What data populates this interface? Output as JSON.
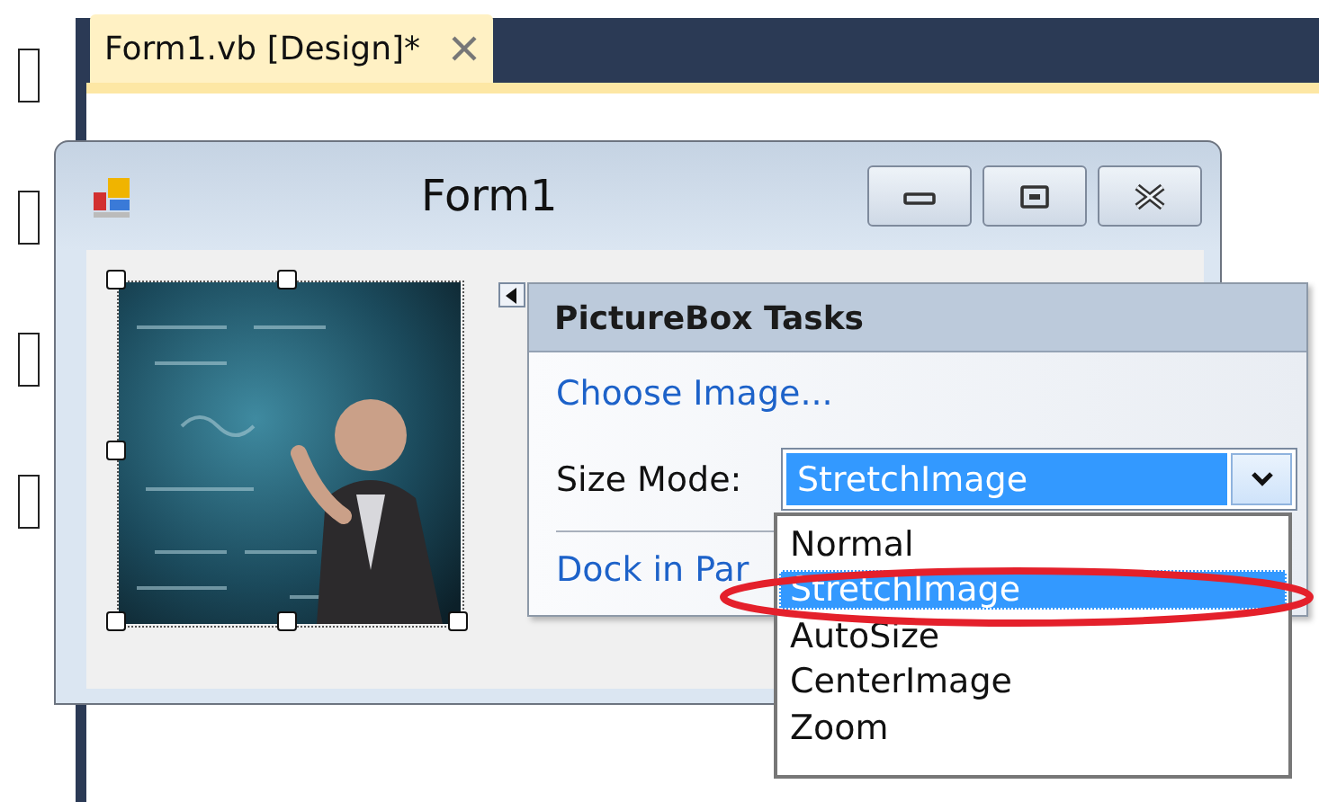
{
  "left_gutter": [
    {
      "kind": "box"
    },
    {
      "kind": "box"
    },
    {
      "kind": "box"
    },
    {
      "kind": "box"
    }
  ],
  "tabs": [
    {
      "label": "Form1.vb [Design]*",
      "selected": true
    }
  ],
  "form": {
    "title": "Form1",
    "buttons": [
      {
        "kind": "minimize"
      },
      {
        "kind": "maximize"
      },
      {
        "kind": "close"
      }
    ],
    "picture_box": {
      "kind": "picture",
      "selected": true
    }
  },
  "task_panel": {
    "title": "PictureBox Tasks",
    "choose_image": "Choose Image...",
    "size_mode": {
      "label": "Size Mode:",
      "value": "StretchImage"
    },
    "dock": "Dock in Par"
  },
  "dropdown": {
    "items": [
      {
        "label": "Normal",
        "selected": false
      },
      {
        "label": "StretchImage",
        "selected": true
      },
      {
        "label": "AutoSize",
        "selected": false
      },
      {
        "label": "CenterImage",
        "selected": false
      },
      {
        "label": "Zoom",
        "selected": false
      }
    ]
  },
  "annotation": {
    "kind": "ellipse"
  }
}
